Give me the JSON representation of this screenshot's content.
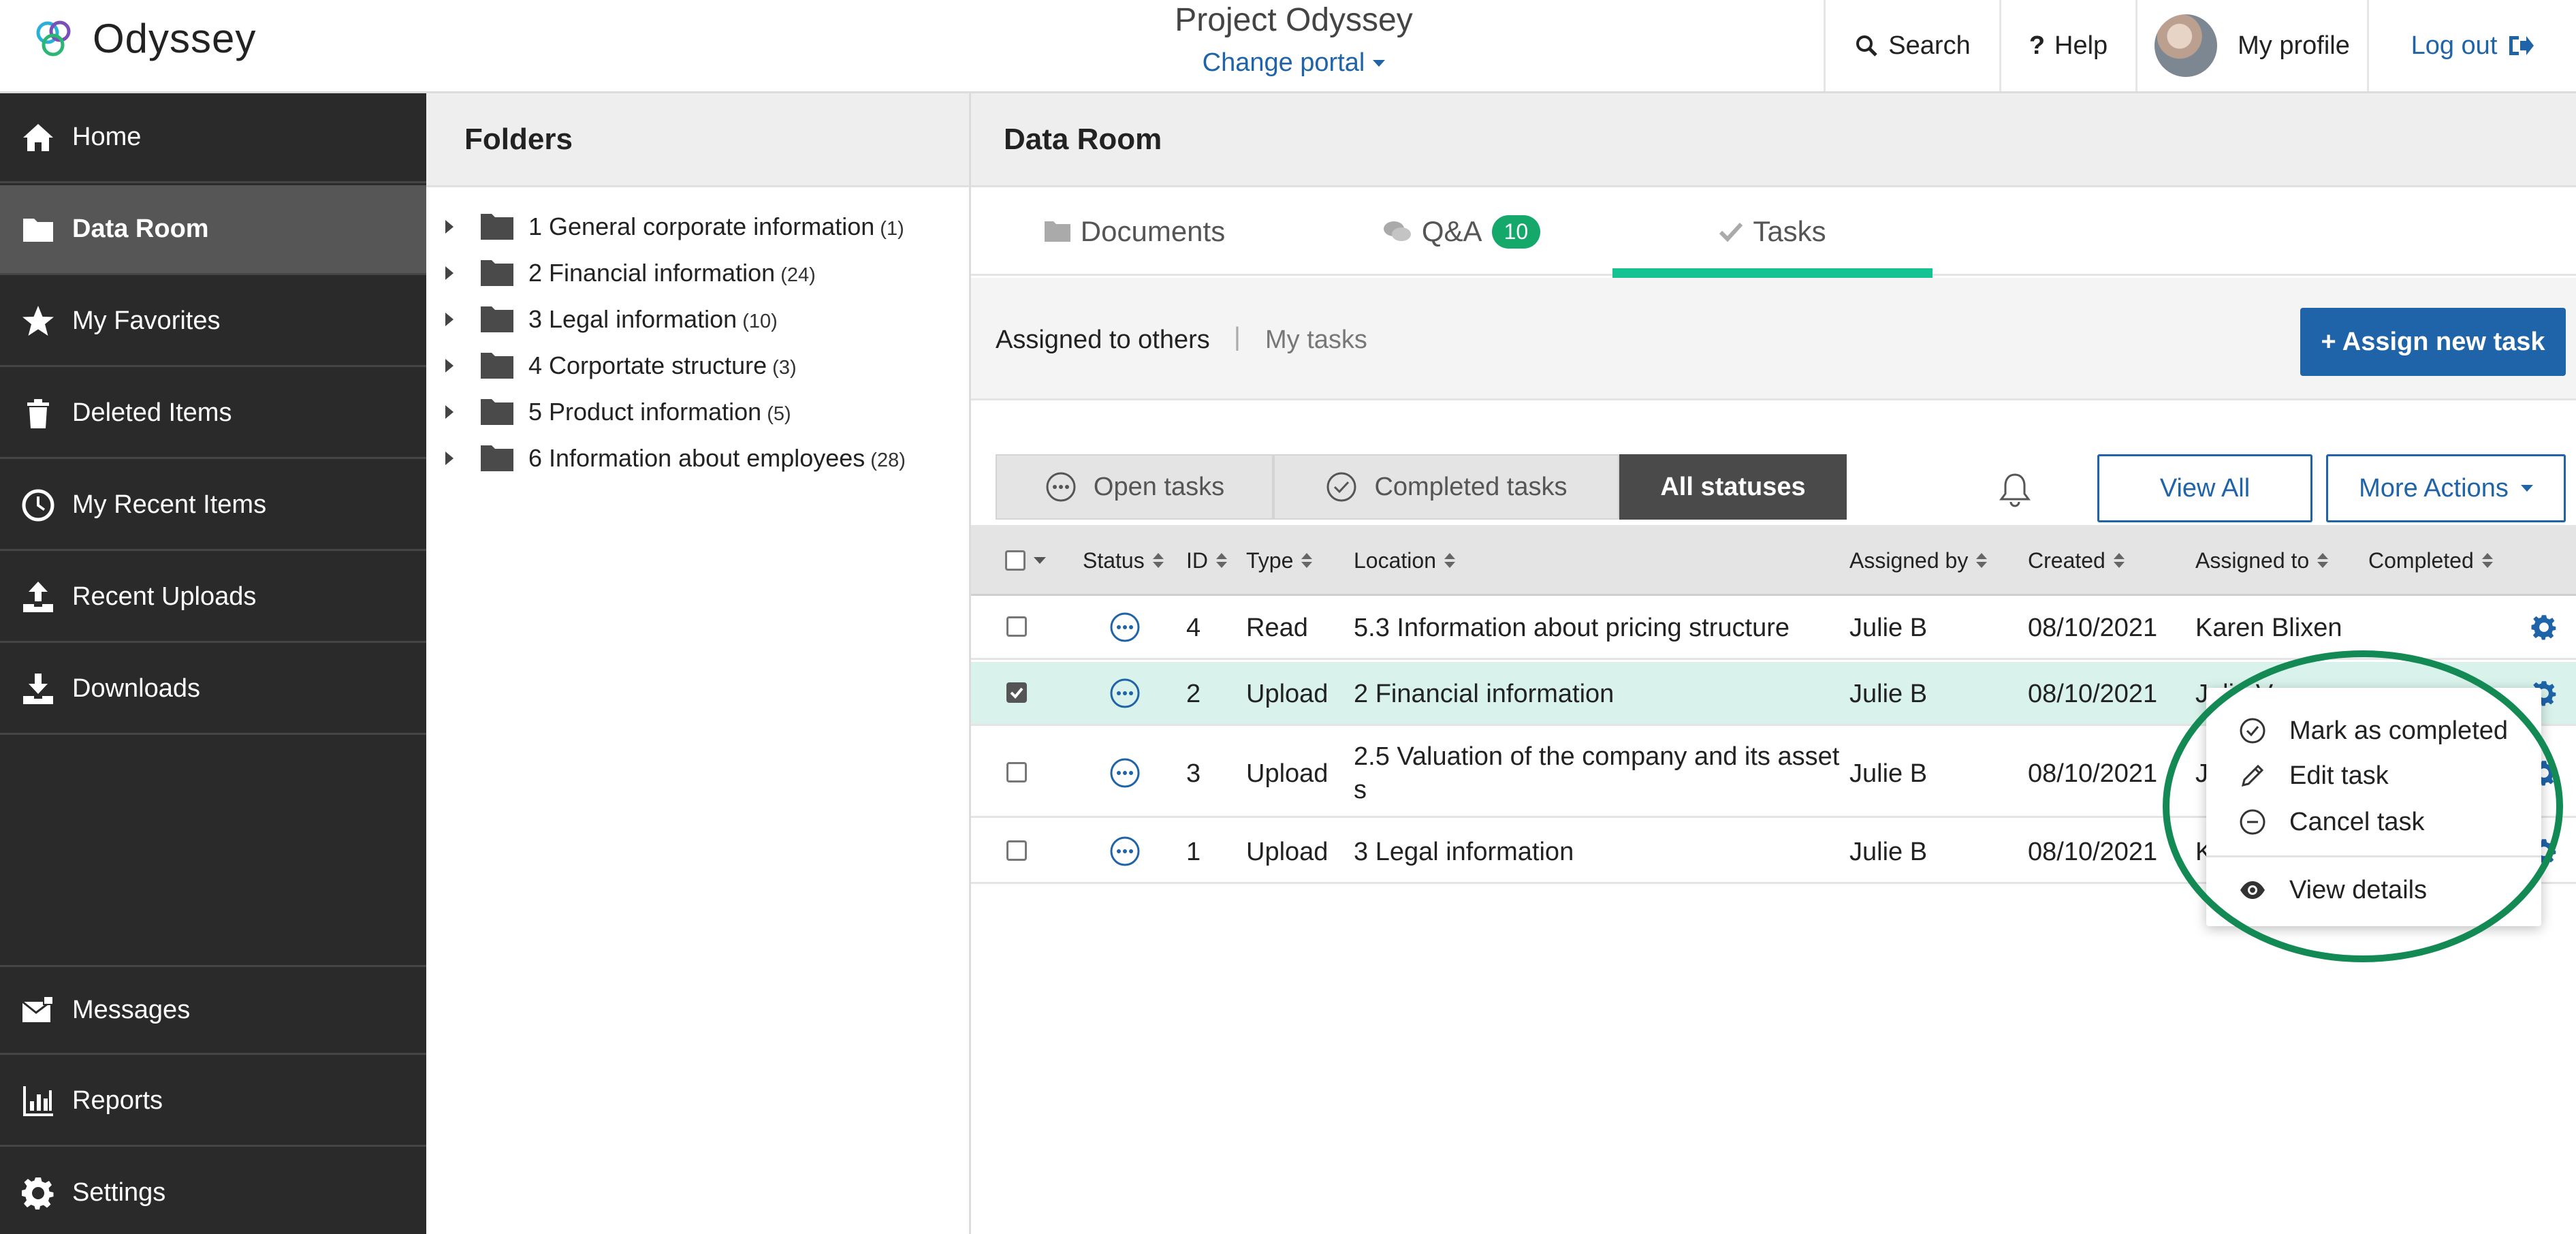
{
  "header": {
    "logo_text": "Odyssey",
    "project_title": "Project Odyssey",
    "change_portal": "Change portal",
    "search": "Search",
    "help": "Help",
    "profile": "My profile",
    "logout": "Log out"
  },
  "sidebar": {
    "items": [
      {
        "label": "Home",
        "icon": "home-icon"
      },
      {
        "label": "Data Room",
        "icon": "folder-icon",
        "active": true
      },
      {
        "label": "My Favorites",
        "icon": "star-icon"
      },
      {
        "label": "Deleted Items",
        "icon": "trash-icon"
      },
      {
        "label": "My Recent Items",
        "icon": "clock-icon"
      },
      {
        "label": "Recent Uploads",
        "icon": "upload-icon"
      },
      {
        "label": "Downloads",
        "icon": "download-icon"
      }
    ],
    "bottom_items": [
      {
        "label": "Messages",
        "icon": "envelope-icon"
      },
      {
        "label": "Reports",
        "icon": "bar-chart-icon"
      },
      {
        "label": "Settings",
        "icon": "gear-icon"
      }
    ]
  },
  "folders": {
    "title": "Folders",
    "items": [
      {
        "name": "1 General corporate information",
        "count": "(1)"
      },
      {
        "name": "2 Financial information",
        "count": "(24)"
      },
      {
        "name": "3 Legal information",
        "count": "(10)"
      },
      {
        "name": "4 Corportate structure",
        "count": "(3)"
      },
      {
        "name": "5 Product information",
        "count": "(5)"
      },
      {
        "name": "6 Information about employees",
        "count": "(28)"
      }
    ]
  },
  "main": {
    "title": "Data Room",
    "tabs": {
      "documents": "Documents",
      "qa": "Q&A",
      "qa_badge": "10",
      "tasks": "Tasks"
    },
    "subtabs": {
      "assigned_to_others": "Assigned to others",
      "separator": "|",
      "my_tasks": "My tasks"
    },
    "assign_button": "+ Assign new task",
    "filters": {
      "open": "Open tasks",
      "completed": "Completed tasks",
      "all": "All statuses"
    },
    "view_all": "View All",
    "more_actions": "More Actions"
  },
  "table": {
    "columns": [
      "Status",
      "ID",
      "Type",
      "Location",
      "Assigned by",
      "Created",
      "Assigned to",
      "Completed"
    ],
    "rows": [
      {
        "id": "4",
        "type": "Read",
        "location": "5.3 Information about pricing structure",
        "assigned_by": "Julie B",
        "created": "08/10/2021",
        "assigned_to": "Karen Blixen",
        "selected": false
      },
      {
        "id": "2",
        "type": "Upload",
        "location": "2 Financial information",
        "assigned_by": "Julie B",
        "created": "08/10/2021",
        "assigned_to": "Julie Verne",
        "selected": true
      },
      {
        "id": "3",
        "type": "Upload",
        "location": "2.5 Valuation of the company and its asset",
        "location_wrap": "s",
        "assigned_by": "Julie B",
        "created": "08/10/2021",
        "assigned_to": "J",
        "selected": false
      },
      {
        "id": "1",
        "type": "Upload",
        "location": "3 Legal information",
        "assigned_by": "Julie B",
        "created": "08/10/2021",
        "assigned_to": "K",
        "selected": false
      }
    ]
  },
  "context_menu": {
    "mark_completed": "Mark as completed",
    "edit_task": "Edit task",
    "cancel_task": "Cancel task",
    "view_details": "View details"
  },
  "colors": {
    "accent_blue": "#1f63a8",
    "tab_underline": "#14c292",
    "sidebar_bg": "#2a2a2a",
    "highlight_ring": "#138a54",
    "selected_row": "#d9f3ec"
  }
}
